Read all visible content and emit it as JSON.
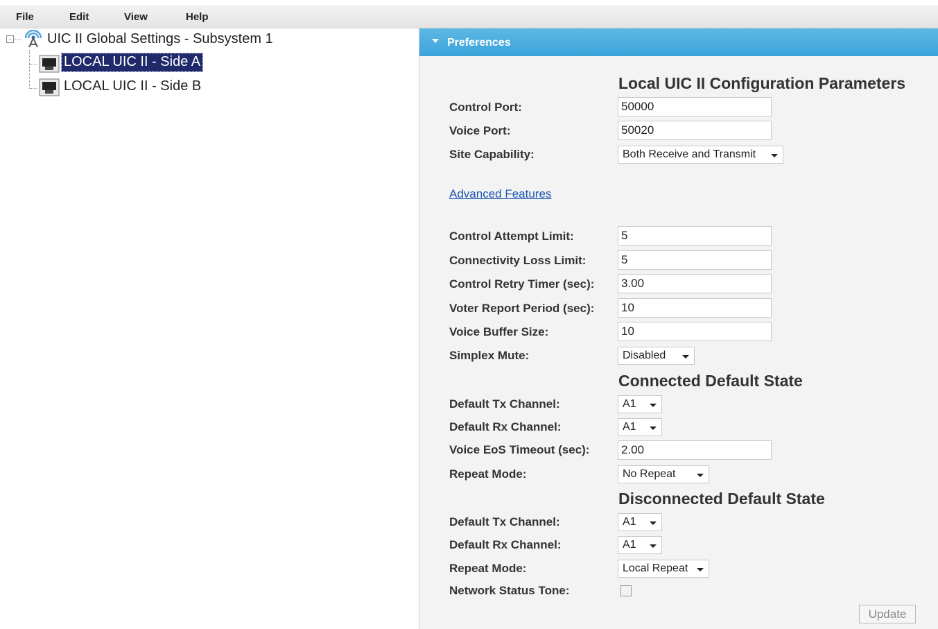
{
  "menu": [
    "File",
    "Edit",
    "View",
    "Help"
  ],
  "tree": {
    "root": {
      "label": "UIC II Global Settings - Subsystem 1",
      "toggle": "-"
    },
    "children": [
      {
        "label": "LOCAL UIC II - Side A",
        "selected": true
      },
      {
        "label": "LOCAL UIC II - Side B",
        "selected": false
      }
    ]
  },
  "panel": {
    "header": "Preferences",
    "local_section": {
      "title": "Local UIC II Configuration Parameters",
      "control_port": {
        "label": "Control Port:",
        "value": "50000"
      },
      "voice_port": {
        "label": "Voice Port:",
        "value": "50020"
      },
      "site_capability": {
        "label": "Site Capability:",
        "value": "Both Receive and Transmit"
      }
    },
    "advanced_link": "Advanced Features",
    "advanced": {
      "control_attempt_limit": {
        "label": "Control Attempt Limit:",
        "value": "5"
      },
      "connectivity_loss_limit": {
        "label": "Connectivity Loss Limit:",
        "value": "5"
      },
      "control_retry_timer": {
        "label": "Control Retry Timer (sec):",
        "value": "3.00"
      },
      "voter_report_period": {
        "label": "Voter Report Period (sec):",
        "value": "10"
      },
      "voice_buffer_size": {
        "label": "Voice Buffer Size:",
        "value": "10"
      },
      "simplex_mute": {
        "label": "Simplex Mute:",
        "value": "Disabled"
      }
    },
    "connected": {
      "title": "Connected Default State",
      "tx_channel": {
        "label": "Default Tx Channel:",
        "value": "A1"
      },
      "rx_channel": {
        "label": "Default Rx Channel:",
        "value": "A1"
      },
      "voice_eos_timeout": {
        "label": "Voice EoS Timeout (sec):",
        "value": "2.00"
      },
      "repeat_mode": {
        "label": "Repeat Mode:",
        "value": "No Repeat"
      }
    },
    "disconnected": {
      "title": "Disconnected Default State",
      "tx_channel": {
        "label": "Default Tx Channel:",
        "value": "A1"
      },
      "rx_channel": {
        "label": "Default Rx Channel:",
        "value": "A1"
      },
      "repeat_mode": {
        "label": "Repeat Mode:",
        "value": "Local Repeat"
      },
      "network_status_tone": {
        "label": "Network Status Tone:",
        "checked": false
      }
    },
    "update_button": "Update"
  },
  "colors": {
    "header_blue": "#3aa3da",
    "selection": "#202a6b",
    "link": "#1f57b3"
  }
}
